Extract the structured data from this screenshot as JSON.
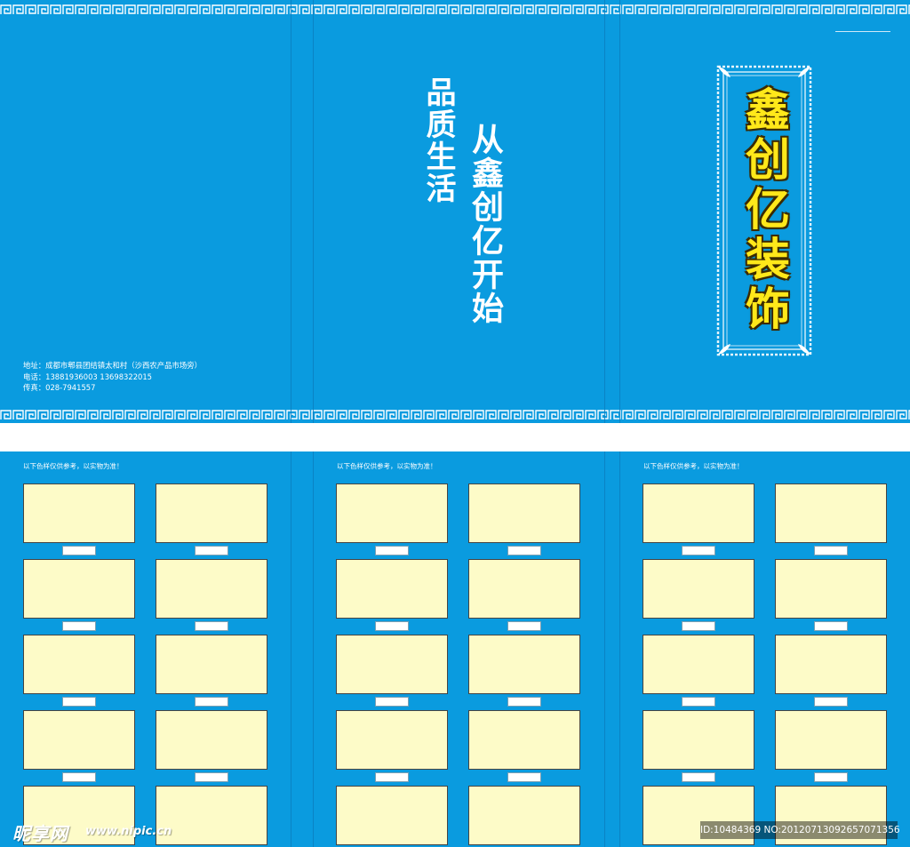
{
  "slogan": {
    "line1": "品质生活",
    "line2": "从鑫创亿开始"
  },
  "brand": {
    "name": "鑫创亿装饰",
    "color": "#ffe81a"
  },
  "contact": {
    "address": "地址：成都市郫县团结镇太和村（沙西农产品市场旁）",
    "phone": "电话：13881936003  13698322015",
    "fax": "传真：028-7941557"
  },
  "sample_note": "以下色样仅供参考，以实物为准！",
  "colors": {
    "background_blue": "#0a9bdf",
    "swatch_fill": "#fdfbc8",
    "border_pattern": "#ffffff"
  },
  "watermark": {
    "logo": "昵享网",
    "url": "www.nipic.cn",
    "id": "ID:10484369 NO:20120713092657071356"
  }
}
